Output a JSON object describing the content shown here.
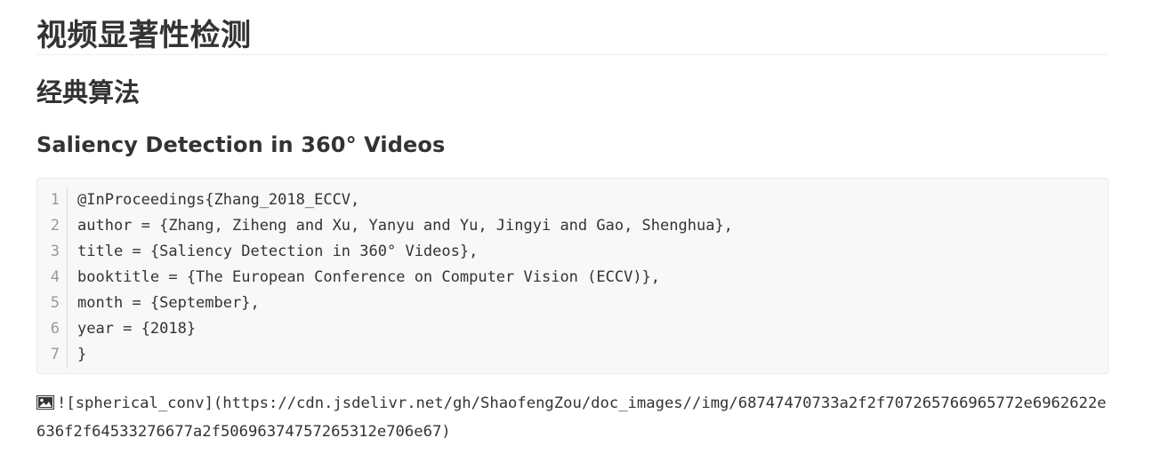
{
  "heading1": "视频显著性检测",
  "heading2": "经典算法",
  "heading3": "Saliency Detection in 360° Videos",
  "code": {
    "line_numbers": [
      "1",
      "2",
      "3",
      "4",
      "5",
      "6",
      "7"
    ],
    "lines": [
      "@InProceedings{Zhang_2018_ECCV,",
      "author = {Zhang, Ziheng and Xu, Yanyu and Yu, Jingyi and Gao, Shenghua},",
      "title = {Saliency Detection in 360° Videos},",
      "booktitle = {The European Conference on Computer Vision (ECCV)},",
      "month = {September},",
      "year = {2018}",
      "}"
    ]
  },
  "image_link": {
    "icon": "broken-image-icon",
    "text": "![spherical_conv](https://cdn.jsdelivr.net/gh/ShaofengZou/doc_images//img/68747470733a2f2f707265766965772e6962622e636f2f64533276677a2f50696374757265312e706e67)"
  }
}
